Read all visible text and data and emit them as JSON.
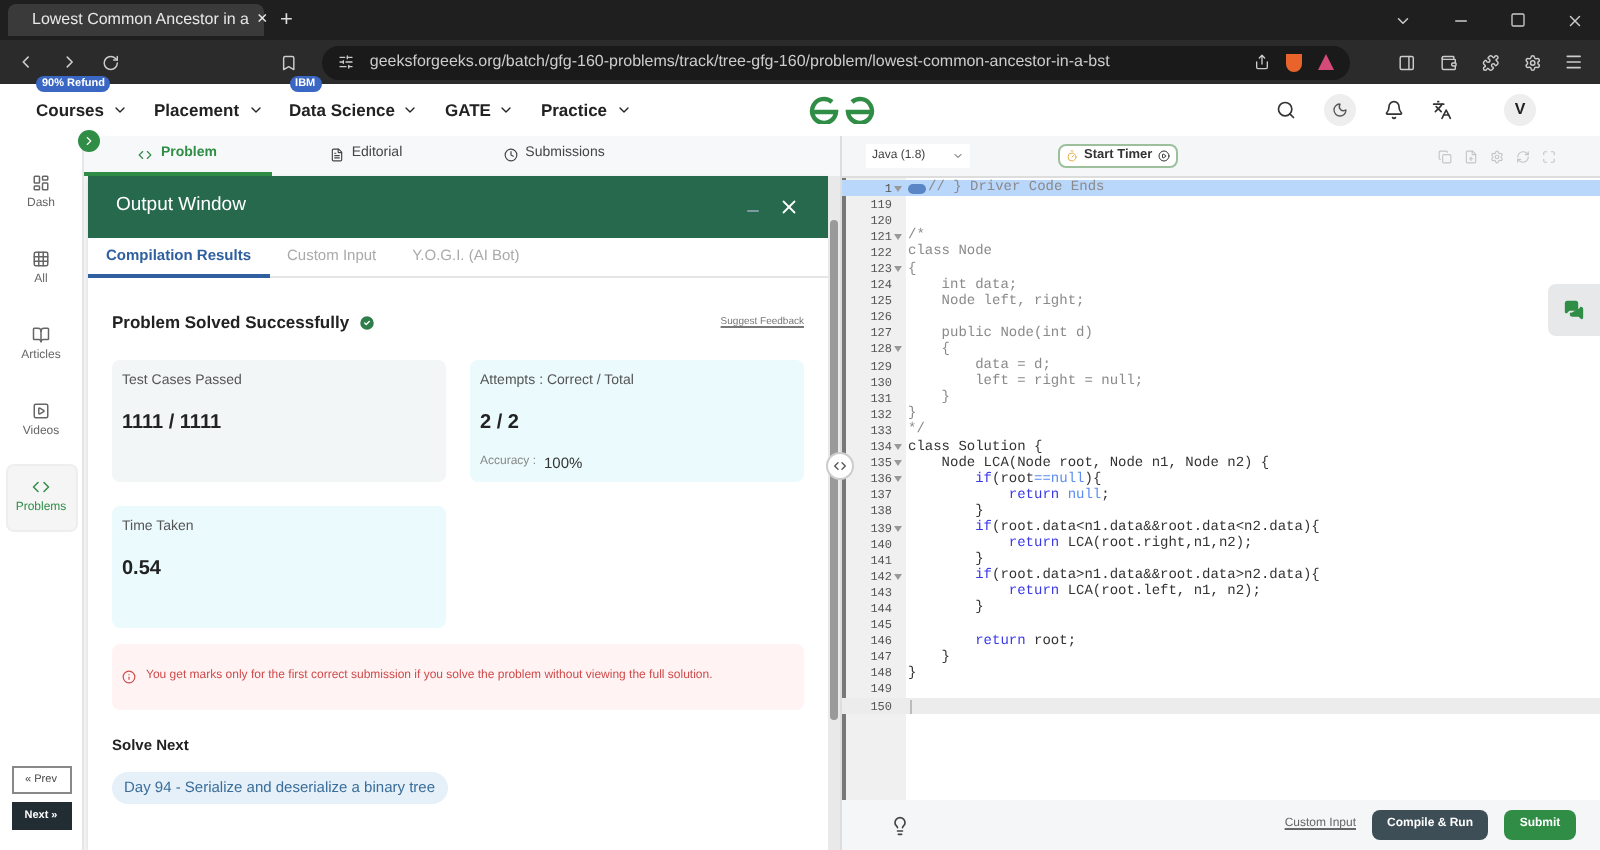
{
  "browser": {
    "tab": {
      "title": "Lowest Common Ancestor in a",
      "close": "×"
    },
    "new_tab": "+",
    "url": "geeksforgeeks.org/batch/gfg-160-problems/track/tree-gfg-160/problem/lowest-common-ancestor-in-a-bst"
  },
  "nav": {
    "items": [
      {
        "label": "Courses",
        "badge": "90% Refund"
      },
      {
        "label": "Placement"
      },
      {
        "label": "Data Science",
        "badge": "IBM"
      },
      {
        "label": "GATE"
      },
      {
        "label": "Practice"
      }
    ],
    "avatar": "V"
  },
  "sidebar": {
    "items": [
      {
        "label": "Dash",
        "selected": false
      },
      {
        "label": "All",
        "selected": false
      },
      {
        "label": "Articles",
        "selected": false
      },
      {
        "label": "Videos",
        "selected": false
      },
      {
        "label": "Problems",
        "selected": true
      }
    ],
    "prev": "« Prev",
    "next": "Next »"
  },
  "problem_tabs": [
    {
      "label": "Problem",
      "selected": true
    },
    {
      "label": "Editorial",
      "selected": false
    },
    {
      "label": "Submissions",
      "selected": false
    }
  ],
  "output_window": {
    "title": "Output Window",
    "tabs": [
      {
        "label": "Compilation Results",
        "selected": true
      },
      {
        "label": "Custom Input",
        "selected": false
      },
      {
        "label": "Y.O.G.I. (AI Bot)",
        "selected": false
      }
    ],
    "status": "Problem Solved Successfully",
    "feedback": "Suggest Feedback",
    "cards": [
      {
        "label": "Test Cases Passed",
        "value": "1111 / 1111",
        "color": "#f2f6f6"
      },
      {
        "label": "Attempts : Correct / Total",
        "value": "2 / 2",
        "sub_label": "Accuracy :",
        "sub_value": "100%",
        "color": "#ebfafd"
      },
      {
        "label": "Time Taken",
        "value": "0.54",
        "color": "#ebfafd"
      }
    ],
    "notice": "You get marks only for the first correct submission if you solve the problem without viewing the full solution.",
    "solve_next": {
      "heading": "Solve Next",
      "problem": "Day 94 - Serialize and deserialize a binary tree"
    }
  },
  "editor": {
    "language": "Java (1.8)",
    "timer": "Start Timer",
    "lines": [
      {
        "number": "1",
        "fold": true,
        "kind": "selected",
        "tokens": [
          {
            "kind": "comment",
            "text": "// } Driver Code Ends"
          }
        ]
      },
      {
        "number": "119",
        "fold": false,
        "kind": "normal"
      },
      {
        "number": "120",
        "fold": false,
        "kind": "normal"
      },
      {
        "number": "121",
        "fold": true,
        "kind": "normal",
        "tokens": [
          {
            "kind": "comment",
            "text": "/*"
          }
        ]
      },
      {
        "number": "122",
        "fold": false,
        "kind": "normal",
        "tokens": [
          {
            "kind": "comment",
            "text": "class Node"
          }
        ]
      },
      {
        "number": "123",
        "fold": true,
        "kind": "normal",
        "tokens": [
          {
            "kind": "comment",
            "text": "{"
          }
        ]
      },
      {
        "number": "124",
        "fold": false,
        "kind": "normal",
        "tokens": [
          {
            "kind": "comment",
            "text": "    int data;"
          }
        ]
      },
      {
        "number": "125",
        "fold": false,
        "kind": "normal",
        "tokens": [
          {
            "kind": "comment",
            "text": "    Node left, right;"
          }
        ]
      },
      {
        "number": "126",
        "fold": false,
        "kind": "normal"
      },
      {
        "number": "127",
        "fold": false,
        "kind": "normal",
        "tokens": [
          {
            "kind": "comment",
            "text": "    public Node(int d)"
          }
        ]
      },
      {
        "number": "128",
        "fold": true,
        "kind": "normal",
        "tokens": [
          {
            "kind": "comment",
            "text": "    {"
          }
        ]
      },
      {
        "number": "129",
        "fold": false,
        "kind": "normal",
        "tokens": [
          {
            "kind": "comment",
            "text": "        data = d;"
          }
        ]
      },
      {
        "number": "130",
        "fold": false,
        "kind": "normal",
        "tokens": [
          {
            "kind": "comment",
            "text": "        left = right = null;"
          }
        ]
      },
      {
        "number": "131",
        "fold": false,
        "kind": "normal",
        "tokens": [
          {
            "kind": "comment",
            "text": "    }"
          }
        ]
      },
      {
        "number": "132",
        "fold": false,
        "kind": "normal",
        "tokens": [
          {
            "kind": "comment",
            "text": "}"
          }
        ]
      },
      {
        "number": "133",
        "fold": false,
        "kind": "normal",
        "tokens": [
          {
            "kind": "comment",
            "text": "*/"
          }
        ]
      },
      {
        "number": "134",
        "fold": true,
        "kind": "normal",
        "tokens": [
          {
            "kind": "plain",
            "text": "class Solution {"
          }
        ]
      },
      {
        "number": "135",
        "fold": true,
        "kind": "normal",
        "tokens": [
          {
            "kind": "plain",
            "text": "    Node LCA(Node root, Node n1, Node n2) {"
          }
        ]
      },
      {
        "number": "136",
        "fold": true,
        "kind": "normal",
        "tokens": [
          {
            "kind": "keyword",
            "text": "        if"
          },
          {
            "kind": "plain",
            "text": "(root"
          },
          {
            "kind": "literal",
            "text": "==null"
          },
          {
            "kind": "plain",
            "text": "){"
          }
        ]
      },
      {
        "number": "137",
        "fold": false,
        "kind": "normal",
        "tokens": [
          {
            "kind": "keyword",
            "text": "            return"
          },
          {
            "kind": "literal",
            "text": " null"
          },
          {
            "kind": "plain",
            "text": ";"
          }
        ]
      },
      {
        "number": "138",
        "fold": false,
        "kind": "normal",
        "tokens": [
          {
            "kind": "plain",
            "text": "        }"
          }
        ]
      },
      {
        "number": "139",
        "fold": true,
        "kind": "normal",
        "tokens": [
          {
            "kind": "keyword",
            "text": "        if"
          },
          {
            "kind": "plain",
            "text": "(root.data<n1.data&&root.data<n2.data){"
          }
        ]
      },
      {
        "number": "140",
        "fold": false,
        "kind": "normal",
        "tokens": [
          {
            "kind": "keyword",
            "text": "            return"
          },
          {
            "kind": "plain",
            "text": " LCA(root.right,n1,n2);"
          }
        ]
      },
      {
        "number": "141",
        "fold": false,
        "kind": "normal",
        "tokens": [
          {
            "kind": "plain",
            "text": "        }"
          }
        ]
      },
      {
        "number": "142",
        "fold": true,
        "kind": "normal",
        "tokens": [
          {
            "kind": "keyword",
            "text": "        if"
          },
          {
            "kind": "plain",
            "text": "(root.data>n1.data&&root.data>n2.data){"
          }
        ]
      },
      {
        "number": "143",
        "fold": false,
        "kind": "normal",
        "tokens": [
          {
            "kind": "keyword",
            "text": "            return"
          },
          {
            "kind": "plain",
            "text": " LCA(root.left, n1, n2);"
          }
        ]
      },
      {
        "number": "144",
        "fold": false,
        "kind": "normal",
        "tokens": [
          {
            "kind": "plain",
            "text": "        }"
          }
        ]
      },
      {
        "number": "145",
        "fold": false,
        "kind": "normal"
      },
      {
        "number": "146",
        "fold": false,
        "kind": "normal",
        "tokens": [
          {
            "kind": "keyword",
            "text": "        return"
          },
          {
            "kind": "plain",
            "text": " root;"
          }
        ]
      },
      {
        "number": "147",
        "fold": false,
        "kind": "normal",
        "tokens": [
          {
            "kind": "plain",
            "text": "    }"
          }
        ]
      },
      {
        "number": "148",
        "fold": false,
        "kind": "normal",
        "tokens": [
          {
            "kind": "plain",
            "text": "}"
          }
        ]
      },
      {
        "number": "149",
        "fold": false,
        "kind": "normal"
      },
      {
        "number": "150",
        "fold": false,
        "kind": "current"
      }
    ],
    "custom_input": "Custom Input",
    "compile": "Compile & Run",
    "submit": "Submit"
  }
}
